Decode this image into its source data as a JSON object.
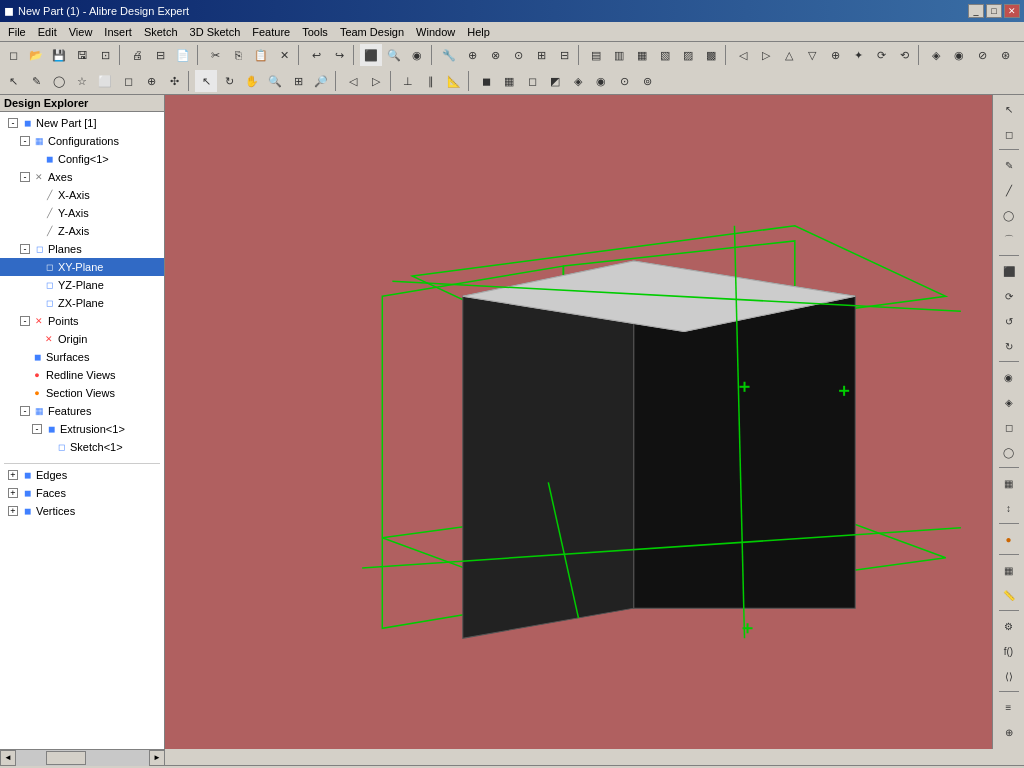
{
  "titleBar": {
    "title": "New Part (1) - Alibre Design Expert",
    "icon": "◼",
    "btns": [
      "_",
      "□",
      "✕"
    ]
  },
  "menuBar": {
    "items": [
      "File",
      "Edit",
      "View",
      "Insert",
      "Sketch",
      "3D Sketch",
      "Feature",
      "Tools",
      "Team Design",
      "Window",
      "Help"
    ]
  },
  "designExplorer": {
    "header": "Design Explorer",
    "tree": [
      {
        "label": "New Part [1]",
        "level": 1,
        "expanded": true,
        "icon": "◼",
        "iconClass": "icon-blue"
      },
      {
        "label": "Configurations",
        "level": 2,
        "expanded": true,
        "icon": "▦",
        "iconClass": "icon-blue"
      },
      {
        "label": "Config<1>",
        "level": 3,
        "icon": "◼",
        "iconClass": "icon-blue"
      },
      {
        "label": "Axes",
        "level": 2,
        "expanded": true,
        "icon": "✕",
        "iconClass": "icon-gray"
      },
      {
        "label": "X-Axis",
        "level": 3,
        "icon": "—",
        "iconClass": "icon-gray"
      },
      {
        "label": "Y-Axis",
        "level": 3,
        "icon": "—",
        "iconClass": "icon-gray"
      },
      {
        "label": "Z-Axis",
        "level": 3,
        "icon": "—",
        "iconClass": "icon-gray"
      },
      {
        "label": "Planes",
        "level": 2,
        "expanded": true,
        "icon": "◻",
        "iconClass": "icon-blue"
      },
      {
        "label": "XY-Plane",
        "level": 3,
        "icon": "◻",
        "iconClass": "icon-blue",
        "selected": true
      },
      {
        "label": "YZ-Plane",
        "level": 3,
        "icon": "◻",
        "iconClass": "icon-blue"
      },
      {
        "label": "ZX-Plane",
        "level": 3,
        "icon": "◻",
        "iconClass": "icon-blue"
      },
      {
        "label": "Points",
        "level": 2,
        "expanded": true,
        "icon": "✕",
        "iconClass": "icon-red"
      },
      {
        "label": "Origin",
        "level": 3,
        "icon": "✕",
        "iconClass": "icon-red"
      },
      {
        "label": "Surfaces",
        "level": 2,
        "icon": "◼",
        "iconClass": "icon-blue"
      },
      {
        "label": "Redline Views",
        "level": 2,
        "icon": "●",
        "iconClass": "icon-red"
      },
      {
        "label": "Section Views",
        "level": 2,
        "icon": "●",
        "iconClass": "icon-orange"
      },
      {
        "label": "Features",
        "level": 2,
        "expanded": true,
        "icon": "▦",
        "iconClass": "icon-blue"
      },
      {
        "label": "Extrusion<1>",
        "level": 3,
        "expanded": true,
        "icon": "◼",
        "iconClass": "icon-blue"
      },
      {
        "label": "Sketch<1>",
        "level": 4,
        "icon": "◻",
        "iconClass": "icon-blue"
      },
      {
        "label": "",
        "level": 1,
        "icon": "",
        "separator": true
      },
      {
        "label": "Edges",
        "level": 2,
        "expandable": true,
        "icon": "◼",
        "iconClass": "icon-blue"
      },
      {
        "label": "Faces",
        "level": 2,
        "expandable": true,
        "icon": "◼",
        "iconClass": "icon-blue"
      },
      {
        "label": "Vertices",
        "level": 2,
        "expandable": true,
        "icon": "◼",
        "iconClass": "icon-blue"
      }
    ]
  },
  "viewport": {
    "bgColor": "#b06060"
  },
  "rightToolbar": {
    "buttons": [
      "↖",
      "◻",
      "◯",
      "⚡",
      "◼",
      "▦",
      "⊕",
      "◯",
      "↺",
      "↻",
      "⊙",
      "✦",
      "●",
      "▣",
      "◻",
      "◯",
      "▦",
      "↕",
      "◉",
      "⚙",
      "f()",
      "⟨⟩",
      "≡"
    ]
  },
  "statusBar": {
    "parts": [
      "",
      "",
      ""
    ]
  }
}
